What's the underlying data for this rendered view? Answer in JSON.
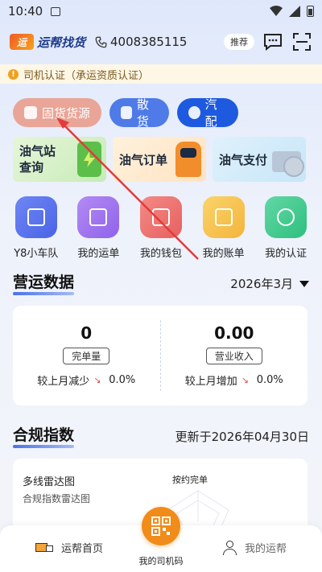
{
  "status": {
    "time": "10:40"
  },
  "header": {
    "app_name": "运帮找货",
    "phone": "4008385115",
    "recommend": "推荐"
  },
  "cert_notice": "司机认证（承运资质认证）",
  "pills": [
    {
      "label": "固货货源",
      "icon": "cube-icon"
    },
    {
      "label": "散货",
      "icon": "card-icon"
    },
    {
      "label": "汽配",
      "icon": "globe-icon"
    }
  ],
  "banners": [
    {
      "label": "油气站查询",
      "icon": "fuel-pump-icon"
    },
    {
      "label": "油气订单",
      "icon": "robot-fuel-icon"
    },
    {
      "label": "油气支付",
      "icon": "card-coin-icon"
    }
  ],
  "grid": [
    {
      "label": "Y8小车队",
      "icon": "fleet-icon"
    },
    {
      "label": "我的运单",
      "icon": "waybill-icon"
    },
    {
      "label": "我的钱包",
      "icon": "wallet-icon"
    },
    {
      "label": "我的账单",
      "icon": "bill-icon"
    },
    {
      "label": "我的认证",
      "icon": "id-card-icon"
    }
  ],
  "ops": {
    "title": "营运数据",
    "month": "2026年3月",
    "completed": {
      "value": "0",
      "tag": "完单量",
      "cmp_label": "较上月减少",
      "cmp_value": "0.0%"
    },
    "revenue": {
      "value": "0.00",
      "tag": "营业收入",
      "cmp_label": "较上月增加",
      "cmp_value": "0.0%"
    }
  },
  "compliance": {
    "title": "合规指数",
    "updated": "更新于2026年04月30日",
    "chart_title": "多线雷达图",
    "chart_subtitle": "合规指数雷达图",
    "radar_label": "按约完单"
  },
  "tabbar": {
    "home": "运帮首页",
    "qr": "我的司机码",
    "mine": "我的运帮"
  },
  "colors": {
    "accent": "#1e5ae0",
    "orange": "#f18c1a",
    "annotation": "#e23b3b"
  }
}
